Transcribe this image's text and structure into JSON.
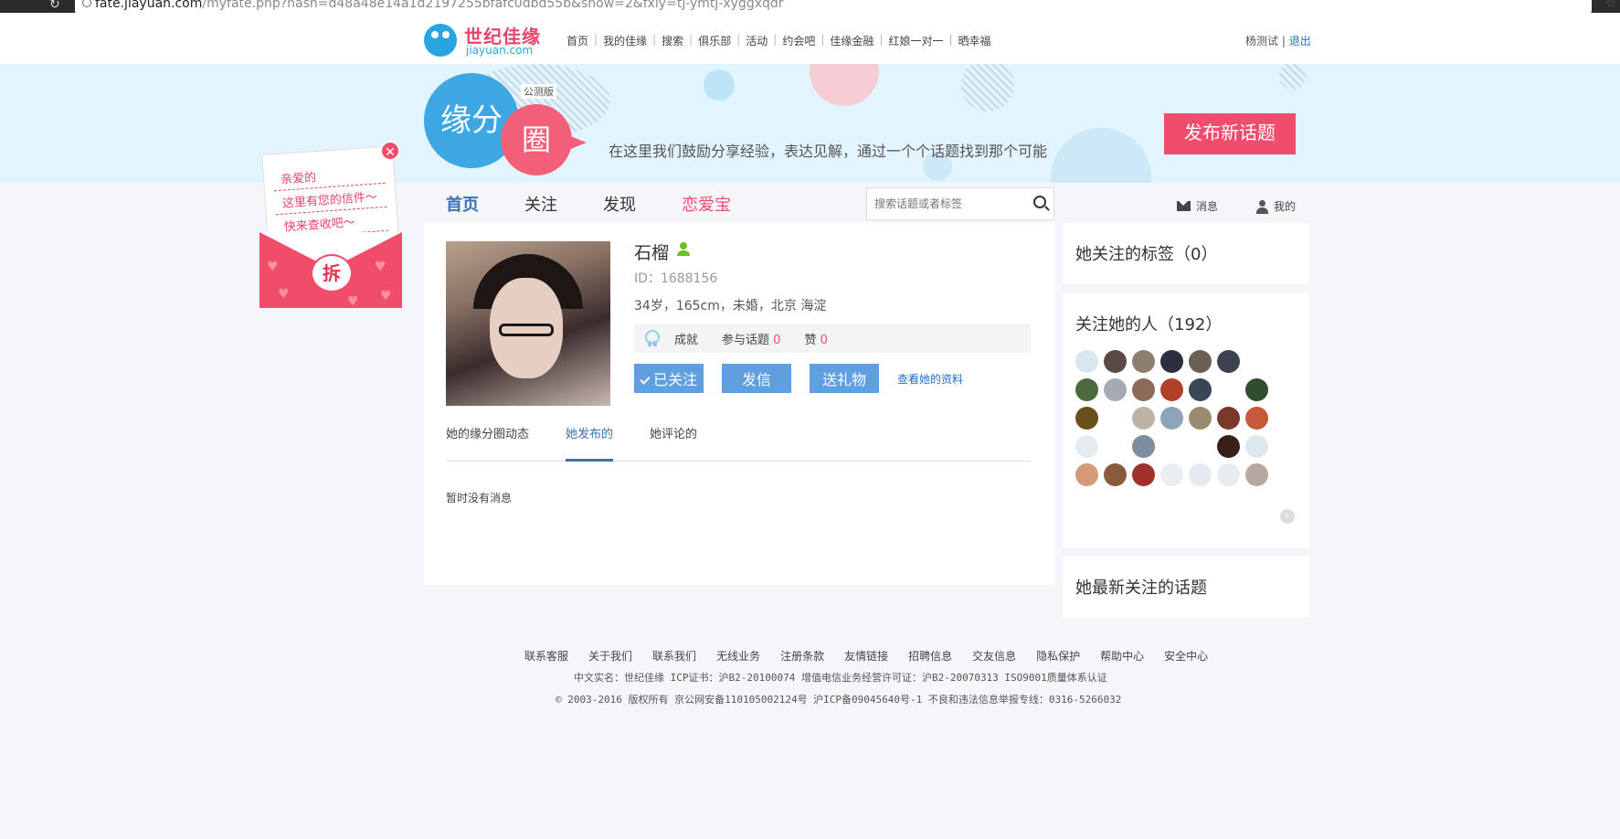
{
  "browser": {
    "url_host": "fate.jiayuan.com",
    "url_path": "/myfate.php?hash=d48a48e14a1d2197255bfafc0dbd55b&show=2&fxly=tj-ymtj-xyggxqdr"
  },
  "logo": {
    "cn": "世纪佳缘",
    "en": "jiayuan.com"
  },
  "topnav": {
    "links": [
      "首页",
      "我的佳缘",
      "搜索",
      "俱乐部",
      "活动",
      "约会吧",
      "佳缘金融",
      "红娘一对一",
      "晒幸福"
    ],
    "user_name": "杨测试",
    "separator": "|",
    "logout": "退出"
  },
  "banner": {
    "badge_left": "缘分",
    "badge_right": "圈",
    "beta": "公测版",
    "slogan": "在这里我们鼓励分享经验，表达见解，通过一个个话题找到那个可能",
    "publish_button": "发布新话题"
  },
  "envelope": {
    "lines": [
      "亲爱的",
      "这里有您的信件～",
      "快来查收吧～"
    ],
    "open_label": "拆",
    "close_label": "✕"
  },
  "main_tabs": [
    {
      "label": "首页",
      "active": true
    },
    {
      "label": "关注",
      "active": false
    },
    {
      "label": "发现",
      "active": false
    },
    {
      "label": "恋爱宝",
      "active": false
    }
  ],
  "search": {
    "placeholder": "搜索话题或者标签"
  },
  "right_links": {
    "messages": "消息",
    "mine": "我的"
  },
  "profile": {
    "name": "石榴",
    "id_text": "ID：1688156",
    "info": "34岁，165cm，未婚，北京 海淀",
    "stats": {
      "achievement_label": "成就",
      "topics_label": "参与话题",
      "topics_count": "0",
      "likes_label": "赞",
      "likes_count": "0"
    },
    "actions": {
      "followed": "已关注",
      "send_letter": "发信",
      "send_gift": "送礼物",
      "view_profile": "查看她的资料"
    },
    "sub_tabs": [
      "她的缘分圈动态",
      "她发布的",
      "她评论的"
    ],
    "active_sub_tab": "她发布的",
    "empty_message": "暂时没有消息"
  },
  "right": {
    "tags_title": "她关注的标签（0）",
    "followers_title": "关注她的人（192）",
    "topics_title": "她最新关注的话题",
    "follower_colors": [
      "#d9e6ee",
      "#5a4a44",
      "#8c7f72",
      "#2d2f3c",
      "#6b5e52",
      "#3c4250",
      "#4e6a3c",
      "#a5a9b4",
      "#8a6a58",
      "#b0402a",
      "#3a4656",
      "#2f4d30",
      "#6a4e1c",
      "#bdb3a6",
      "#8ea4b8",
      "#9a8a70",
      "#7a3a2a",
      "#c45a3a",
      "#dde8ee",
      "#e4ecf2",
      "#7c8da0",
      "#3a1e1a",
      "#b4a8a0",
      "#d49a7a",
      "#8a5a3c",
      "#a0302a",
      "#e8eef4",
      "#e4eaf0",
      "#e6ecf2"
    ],
    "more_arrow": "›"
  },
  "footer": {
    "links": [
      "联系客服",
      "关于我们",
      "联系我们",
      "无线业务",
      "注册条款",
      "友情链接",
      "招聘信息",
      "交友信息",
      "隐私保护",
      "帮助中心",
      "安全中心"
    ],
    "line1": "中文实名：世纪佳缘   ICP证书：沪B2-20100074   增值电信业务经营许可证：沪B2-20070313   ISO9001质量体系认证",
    "line2": "©  2003-2016  版权所有   京公网安备110105002124号   沪ICP备09045640号-1   不良和违法信息举报专线：0316-5266032"
  }
}
